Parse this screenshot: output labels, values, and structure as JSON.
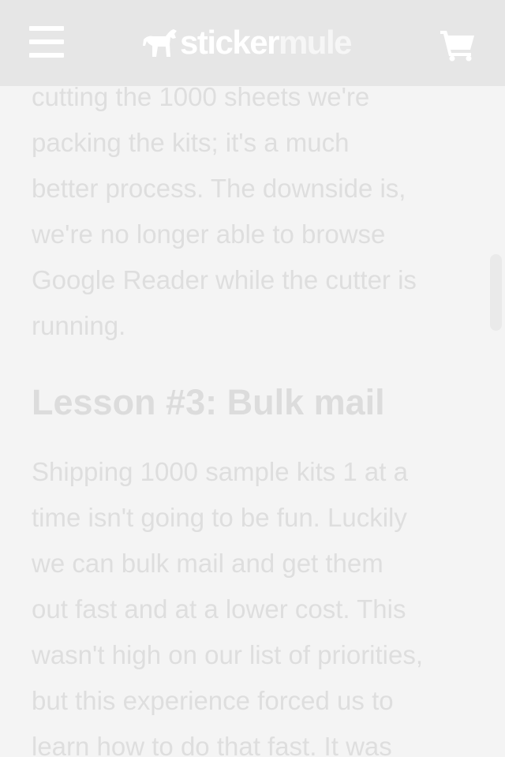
{
  "header": {
    "menu_icon": "hamburger-menu-icon",
    "logo": {
      "part1": "sticker",
      "part2": "mule",
      "mark_icon": "mule-logo-icon"
    },
    "cart_icon": "shopping-cart-icon"
  },
  "article": {
    "para1_lines": [
      "cutting the 1000 sheets we're",
      "packing the kits; it's a much",
      "better process. The downside is,",
      "we're no longer able to browse",
      "Google Reader while the cutter is",
      "running."
    ],
    "heading": "Lesson #3: Bulk mail",
    "para2_lines": [
      "Shipping 1000 sample kits 1 at a",
      "time isn't going to be fun. Luckily",
      "we can bulk mail and get them",
      "out fast and at a lower cost. This",
      "wasn't high on our list of priorities,",
      "but this experience forced us to",
      "learn how to do that fast. It was"
    ]
  },
  "colors": {
    "header_bg": "#e6e6e6",
    "page_bg": "#f4f4f4",
    "text": "#dedede"
  }
}
